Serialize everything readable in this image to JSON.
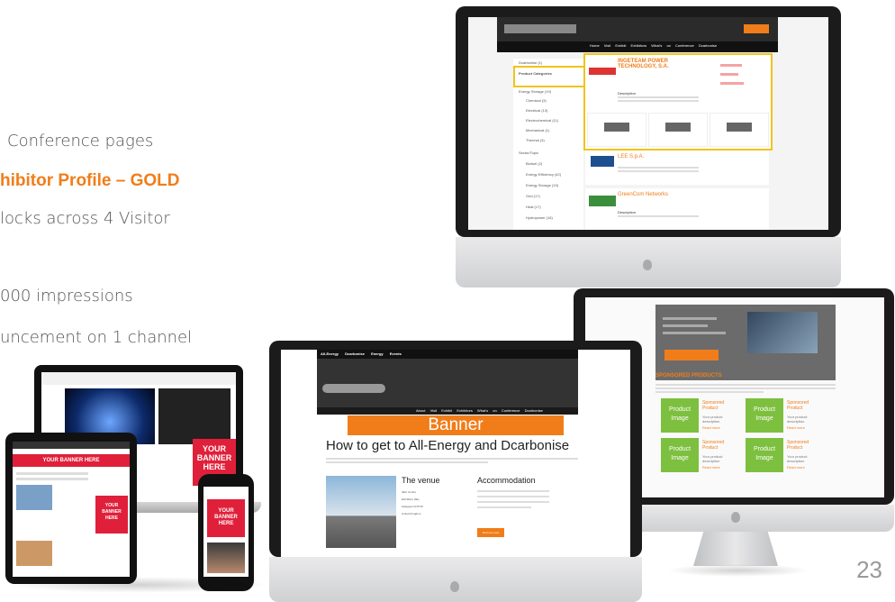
{
  "bullets": {
    "line1": "Conference pages",
    "line2": "hibitor Profile – GOLD",
    "line3": "locks across 4 Visitor",
    "line4": "000 impressions",
    "line5": "uncement on 1 channel"
  },
  "screen_top": {
    "nav": [
      "Home",
      "Visit",
      "Exhibit",
      "Exhibitors",
      "What's on",
      "Conference",
      "Dcarbonise"
    ],
    "sidebar_items": [
      "Dcarbonise (1)",
      "Product Categories",
      "Energy Storage (19)",
      "Chemical (3)",
      "Electrical (13)",
      "Electrochemical (11)",
      "Mechanical (1)",
      "Thermal (3)",
      "Sector/Topic",
      "Biofuel (2)",
      "Energy Efficiency (42)",
      "Energy Storage (19)",
      "Grid (17)",
      "Heat (17)",
      "Hydropower (16)"
    ],
    "exhibitors": [
      {
        "name": "INGETEAM POWER TECHNOLOGY, S.A.",
        "label": "Description"
      },
      {
        "name": "LEE S.p.A.",
        "label": "Description"
      },
      {
        "name": "GreenCom Networks",
        "label": "Description"
      }
    ]
  },
  "screen_mid": {
    "top_links": [
      "All-Energy",
      "Dcarbonise",
      "Energy Events"
    ],
    "nav": [
      "About",
      "Visit",
      "Exhibit",
      "Exhibitors",
      "What's on",
      "Conference",
      "Dcarbonise"
    ],
    "banner": "Banner",
    "heading": "How to get to All-Energy and Dcarbonise",
    "venue_title": "The venue",
    "venue_lines": [
      "SEC Centre",
      "Exhibition Way",
      "Glasgow G3 8YW",
      "United Kingdom"
    ],
    "accommodation_title": "Accommodation",
    "button": "Find out more"
  },
  "screen_right": {
    "section_title": "SPONSORED PRODUCTS",
    "product_image": "Product Image",
    "sponsored": "Sponsored Product",
    "desc": "Your product description",
    "read_more": "Read more"
  },
  "devices": {
    "banner_text": "YOUR BANNER HERE",
    "tablet_banner": "YOUR BANNER HERE"
  },
  "page_number": "23"
}
